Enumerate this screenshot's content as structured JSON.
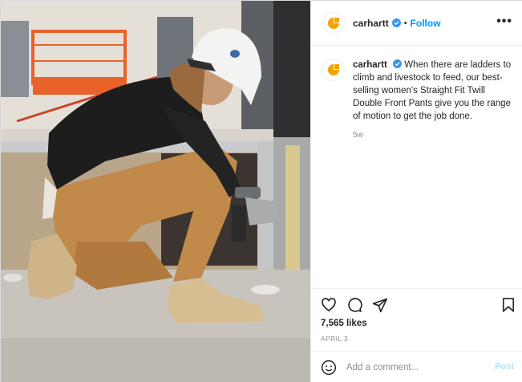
{
  "post": {
    "username": "carhartt",
    "follow_label": "Follow",
    "separator": "•",
    "more_label": "•••",
    "caption_text": "When there are ladders to climb and livestock to feed, our best-selling women's Straight Fit Twill Double Front Pants give you the range of motion to get the job done.",
    "caption_time": "5w",
    "likes": "7,565 likes",
    "date": "APRIL 3",
    "comment_placeholder": "Add a comment...",
    "post_label": "Post"
  },
  "icons": {
    "like": "heart-icon",
    "comment": "comment-icon",
    "share": "share-icon",
    "save": "bookmark-icon",
    "emoji": "emoji-icon",
    "verified": "verified-badge-icon",
    "avatar": "carhartt-logo"
  },
  "colors": {
    "brand": "#f4a300",
    "link": "#0095f6",
    "verified": "#3897f0",
    "muted": "#8e8e8e",
    "post_disabled": "#b2dffc"
  }
}
